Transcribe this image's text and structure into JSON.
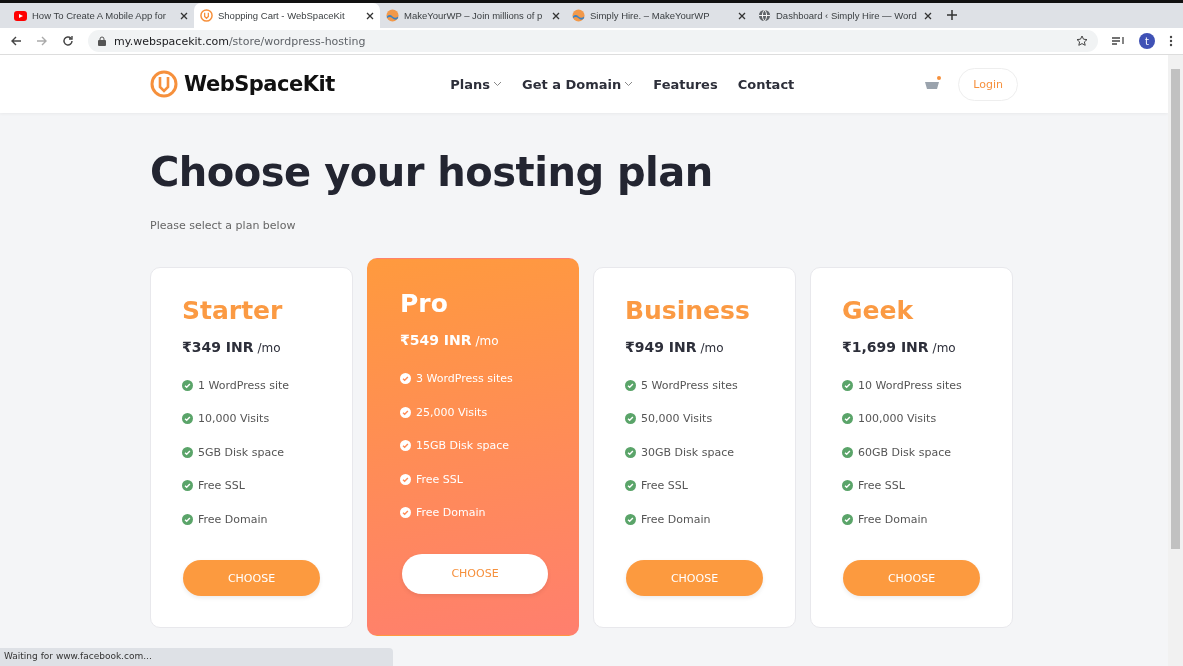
{
  "browser": {
    "tabs": [
      {
        "title": "How To Create A Mobile App for",
        "kind": "video",
        "selected": false
      },
      {
        "title": "Shopping Cart - WebSpaceKit",
        "kind": "logo",
        "selected": true
      },
      {
        "title": "MakeYourWP – Join millions of p",
        "kind": "wave",
        "selected": false
      },
      {
        "title": "Simply Hire. – MakeYourWP",
        "kind": "wave",
        "selected": false
      },
      {
        "title": "Dashboard ‹ Simply Hire — Word",
        "kind": "globe",
        "selected": false
      }
    ],
    "url_host": "my.webspacekit.com",
    "url_path": "/store/wordpress-hosting",
    "profile_initial": "t",
    "status": "Waiting for www.facebook.com..."
  },
  "header": {
    "brand": "WebSpaceKit",
    "nav": [
      {
        "label": "Plans",
        "dropdown": true
      },
      {
        "label": "Get a Domain",
        "dropdown": true
      },
      {
        "label": "Features",
        "dropdown": false
      },
      {
        "label": "Contact",
        "dropdown": false
      }
    ],
    "login": "Login"
  },
  "title": "Choose your hosting plan",
  "subtitle": "Please select a plan below",
  "plans": [
    {
      "name": "Starter",
      "price": "₹349 INR",
      "period": "/mo",
      "featured": false,
      "features": [
        "1 WordPress site",
        "10,000 Visits",
        "5GB Disk space",
        "Free SSL",
        "Free Domain"
      ],
      "button": "CHOOSE"
    },
    {
      "name": "Pro",
      "price": "₹549 INR",
      "period": "/mo",
      "featured": true,
      "features": [
        "3 WordPress sites",
        "25,000 Visits",
        "15GB Disk space",
        "Free SSL",
        "Free Domain"
      ],
      "button": "CHOOSE"
    },
    {
      "name": "Business",
      "price": "₹949 INR",
      "period": "/mo",
      "featured": false,
      "features": [
        "5 WordPress sites",
        "50,000 Visits",
        "30GB Disk space",
        "Free SSL",
        "Free Domain"
      ],
      "button": "CHOOSE"
    },
    {
      "name": "Geek",
      "price": "₹1,699 INR",
      "period": "/mo",
      "featured": false,
      "features": [
        "10 WordPress sites",
        "100,000 Visits",
        "60GB Disk space",
        "Free SSL",
        "Free Domain"
      ],
      "button": "CHOOSE"
    }
  ]
}
